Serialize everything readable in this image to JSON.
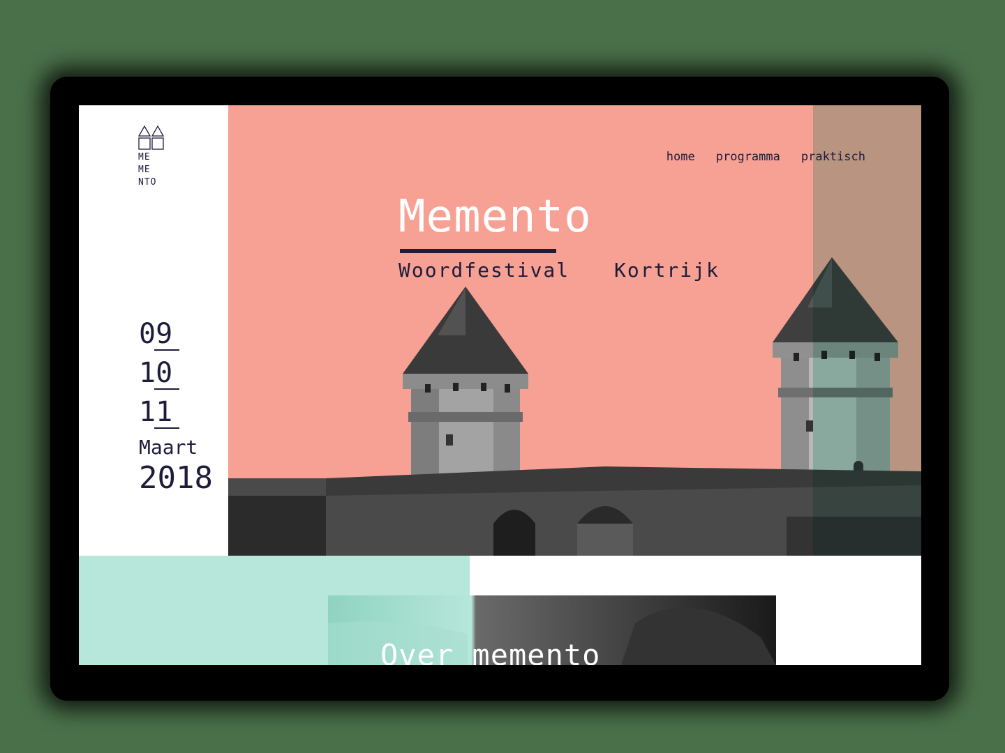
{
  "logo": {
    "text": "ME\nME\nNTO"
  },
  "nav": {
    "items": [
      {
        "label": "home",
        "active": true
      },
      {
        "label": "programma",
        "active": false
      },
      {
        "label": "praktisch",
        "active": false
      }
    ]
  },
  "hero": {
    "title": "Memento",
    "subtitle": "Woordfestival",
    "city": "Kortrijk"
  },
  "dates": {
    "days": [
      "09",
      "10",
      "11"
    ],
    "month": "Maart",
    "year": "2018"
  },
  "section": {
    "title": "Over memento"
  },
  "colors": {
    "coral": "#f7a195",
    "mint": "#b6e7da",
    "navy": "#1d1c3a",
    "accent": "#6ac8b0"
  }
}
